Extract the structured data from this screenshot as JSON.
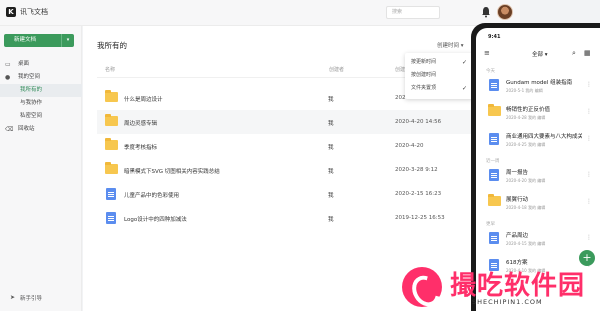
{
  "app": {
    "name": "讯飞文档",
    "logo_letter": "K"
  },
  "topbar": {
    "search_placeholder": "搜索"
  },
  "sidebar": {
    "new_doc_label": "新建文档",
    "items": [
      {
        "label": "桌面",
        "icon": "desktop-icon"
      },
      {
        "label": "我的空间",
        "icon": "space-icon"
      },
      {
        "label": "我所有的"
      },
      {
        "label": "与我协作"
      },
      {
        "label": "私密空间"
      },
      {
        "label": "回收站",
        "icon": "trash-icon"
      }
    ],
    "guide_label": "新手引导"
  },
  "main": {
    "title": "我所有的",
    "sort_label": "创建时间",
    "columns": {
      "name": "名称",
      "owner": "创建者",
      "time": "创建时间"
    },
    "rows": [
      {
        "type": "folder",
        "name": "什么是周边设计",
        "owner": "我",
        "time": "2020-4-20"
      },
      {
        "type": "folder",
        "name": "周边灵感专辑",
        "owner": "我",
        "time": "2020-4-20 14:56"
      },
      {
        "type": "folder",
        "name": "季度考核指标",
        "owner": "我",
        "time": "2020-4-20"
      },
      {
        "type": "folder",
        "name": "暗黑模式下SVG 切图相关内容实践总结",
        "owner": "我",
        "time": "2020-3-28 9:12"
      },
      {
        "type": "doc",
        "name": "儿童产品中的色彩使用",
        "owner": "我",
        "time": "2020-2-15 16:23"
      },
      {
        "type": "doc",
        "name": "Logo设计中的四种加减法",
        "owner": "我",
        "time": "2019-12-25 16:53"
      }
    ],
    "dropdown": [
      {
        "label": "按更新时间",
        "checked": true
      },
      {
        "label": "按创建时间",
        "checked": false
      },
      {
        "label": "文件夹置顶",
        "checked": true
      }
    ]
  },
  "phone": {
    "status_time": "9:41",
    "header_title": "全部",
    "sections": [
      "今天",
      "近一周",
      "更早"
    ],
    "items": [
      {
        "type": "doc",
        "name": "Gundam model 组装指南",
        "meta": "2020-5-1  我的 编辑"
      },
      {
        "type": "folder",
        "name": "畅销性的正反价值",
        "meta": "2020-4-28  我的 编辑"
      },
      {
        "type": "doc",
        "name": "商业通用四大要素与八大构成关系...",
        "meta": "2020-4-25  我的 编辑"
      },
      {
        "type": "doc",
        "name": "周一报告",
        "meta": "2020-4-20  我的 编辑"
      },
      {
        "type": "folder",
        "name": "展翼行动",
        "meta": "2020-4-18  我的 编辑"
      },
      {
        "type": "doc",
        "name": "产品周边",
        "meta": "2020-4-15  我的 编辑"
      },
      {
        "type": "doc",
        "name": "618方案",
        "meta": "2020-4-10  我的 编辑"
      }
    ]
  },
  "watermark": {
    "title": "撮吃软件园",
    "url": "SHECHIPIN1.COM"
  }
}
